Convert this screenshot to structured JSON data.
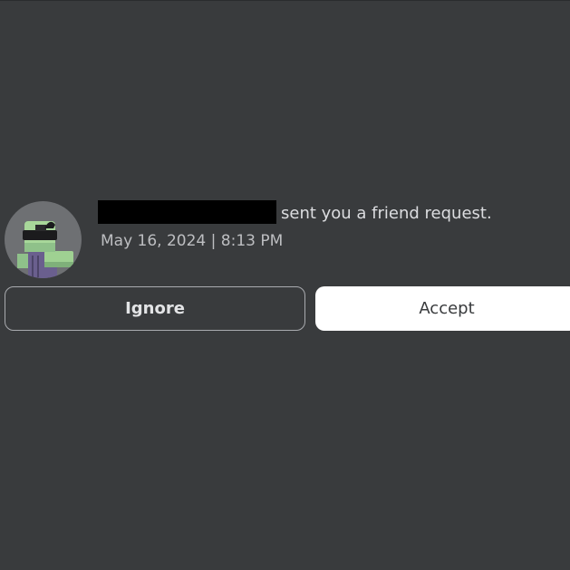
{
  "notification": {
    "message": "sent you a friend request.",
    "timestamp": "May 16, 2024 | 8:13 PM",
    "avatar_icon": "avatar-icon"
  },
  "actions": {
    "ignore_label": "Ignore",
    "accept_label": "Accept"
  },
  "colors": {
    "background": "#393b3d",
    "accept_bg": "#ffffff",
    "ignore_border": "#a9abaf"
  }
}
